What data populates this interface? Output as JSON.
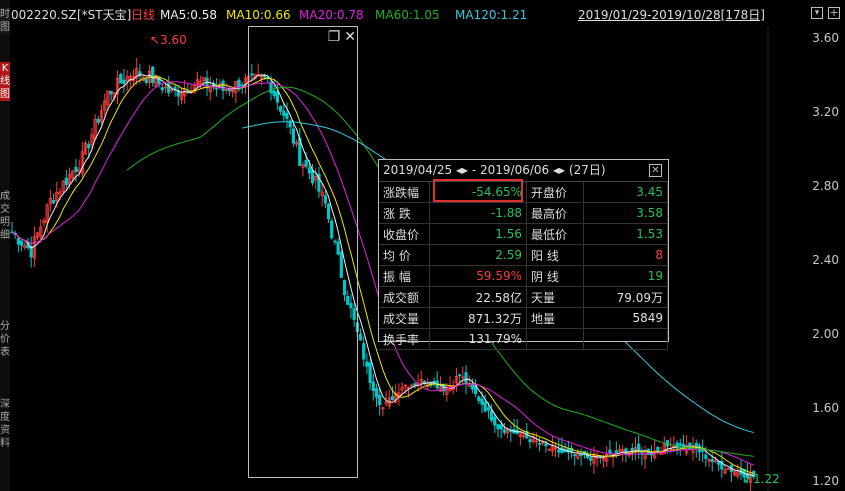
{
  "colors": {
    "up": "#ff3b3b",
    "down": "#00c8c8",
    "ma5": "#f0f0f0",
    "ma10": "#f2e600",
    "ma20": "#e020e0",
    "ma60": "#20b020",
    "ma120": "#38c8e0",
    "green": "#26c25a",
    "red": "#ff3b3b"
  },
  "header": {
    "code": "002220.SZ",
    "name": "[*ST天宝]",
    "period": "日线",
    "ma5": "MA5:0.58",
    "ma10": "MA10:0.66",
    "ma20": "MA20:0.78",
    "ma60": "MA60:1.05",
    "ma120": "MA120:1.21",
    "range": "2019/01/29-2019/10/28[178日]",
    "dropdown_icon": "chevron-down-icon",
    "add_icon": "plus-icon"
  },
  "side_tabs": [
    "时",
    "图",
    "K",
    "线",
    "图",
    "成",
    "交",
    "明",
    "细",
    "分",
    "价",
    "表",
    "深",
    "度",
    "资",
    "料"
  ],
  "chart_data": {
    "type": "candlestick",
    "y_ticks": [
      "3.60",
      "3.20",
      "2.80",
      "2.40",
      "2.00",
      "1.60",
      "1.20"
    ],
    "ylim": [
      1.2,
      3.7
    ],
    "annotations": [
      {
        "text": "3.60",
        "kind": "high"
      },
      {
        "text": "1.22",
        "kind": "low"
      }
    ]
  },
  "selection": {
    "restore_icon": "window-restore-icon",
    "close_icon": "close-icon"
  },
  "info": {
    "date_from": "2019/04/25",
    "date_to": "2019/06/06",
    "arrows": "◂▸",
    "days": "(27日)",
    "close_icon": "close-box-icon",
    "rows": [
      {
        "l1": "涨跌幅",
        "v1": "-54.65%",
        "c1": "g",
        "l2": "开盘价",
        "v2": "3.45",
        "c2": "g"
      },
      {
        "l1": "涨 跌",
        "v1": "-1.88",
        "c1": "g",
        "l2": "最高价",
        "v2": "3.58",
        "c2": "g"
      },
      {
        "l1": "收盘价",
        "v1": "1.56",
        "c1": "g",
        "l2": "最低价",
        "v2": "1.53",
        "c2": "g"
      },
      {
        "l1": "均 价",
        "v1": "2.59",
        "c1": "g",
        "l2": "阳 线",
        "v2": "8",
        "c2": "r"
      },
      {
        "l1": "振 幅",
        "v1": "59.59%",
        "c1": "r",
        "l2": "阴 线",
        "v2": "19",
        "c2": "g"
      },
      {
        "l1": "成交额",
        "v1": "22.58亿",
        "c1": "w",
        "l2": "天量",
        "v2": "79.09万",
        "c2": "w"
      },
      {
        "l1": "成交量",
        "v1": "871.32万",
        "c1": "w",
        "l2": "地量",
        "v2": "5849",
        "c2": "w"
      },
      {
        "l1": "换手率",
        "v1": "131.79%",
        "c1": "w",
        "l2": "",
        "v2": "",
        "c2": "w"
      }
    ]
  }
}
